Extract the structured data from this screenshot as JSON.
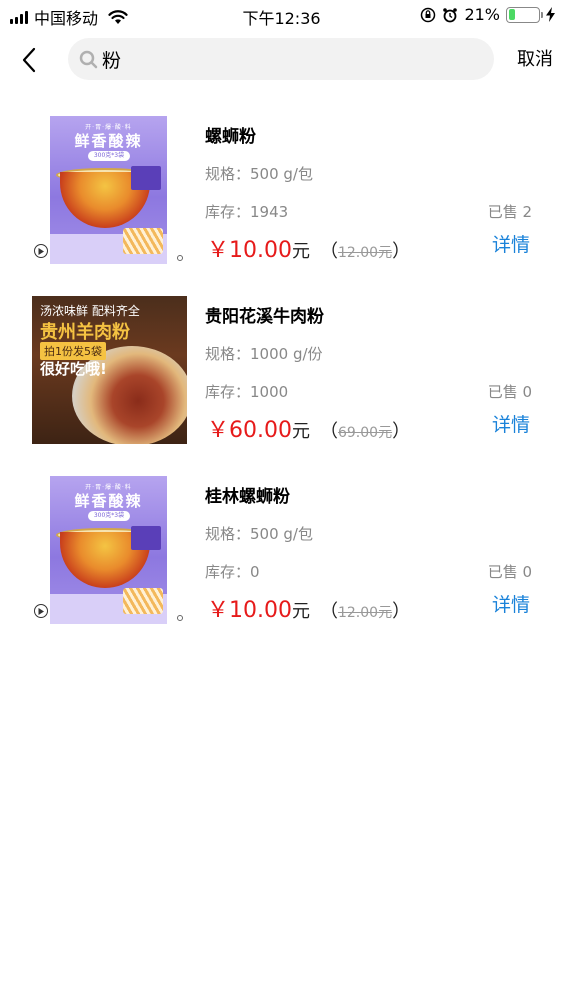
{
  "status_bar": {
    "carrier": "中国移动",
    "time": "下午12:36",
    "battery_percent": "21%",
    "battery_level": 0.21,
    "icons": [
      "signal-icon",
      "wifi-icon",
      "rotation-lock-icon",
      "alarm-icon",
      "battery-icon",
      "charging-icon"
    ]
  },
  "nav": {
    "back_icon": "chevron-left-icon",
    "search_icon": "search-icon",
    "search_value": "粉",
    "cancel_label": "取消"
  },
  "products": [
    {
      "name": "螺蛳粉",
      "spec": "规格：500 g/包",
      "stock": "库存：1943",
      "sold": "已售 2",
      "price": "￥10.00",
      "unit": "元",
      "open_paren": "（",
      "original_price": "12.00元",
      "close_paren": "）",
      "detail_label": "详情",
      "image": {
        "tagline": "开·胃·爆·酸·料",
        "headline": "鲜香酸辣",
        "pill": "300克*3袋"
      }
    },
    {
      "name": "贵阳花溪牛肉粉",
      "spec": "规格：1000 g/份",
      "stock": "库存：1000",
      "sold": "已售 0",
      "price": "￥60.00",
      "unit": "元",
      "open_paren": "（",
      "original_price": "69.00元",
      "close_paren": "）",
      "detail_label": "详情",
      "image": {
        "line1": "汤浓味鲜 配料齐全",
        "line2": "贵州羊肉粉",
        "pill": "拍1份发5袋",
        "line3": "很好吃哦!"
      }
    },
    {
      "name": "桂林螺蛳粉",
      "spec": "规格：500 g/包",
      "stock": "库存：0",
      "sold": "已售 0",
      "price": "￥10.00",
      "unit": "元",
      "open_paren": "（",
      "original_price": "12.00元",
      "close_paren": "）",
      "detail_label": "详情",
      "image": {
        "tagline": "开·胃·爆·酸·料",
        "headline": "鲜香酸辣",
        "pill": "300克*3袋"
      }
    }
  ],
  "colors": {
    "price_red": "#e61a1a",
    "detail_blue": "#1a82d9",
    "muted_gray": "#888888",
    "search_bg": "#f2f2f2",
    "battery_green": "#4cd964"
  }
}
